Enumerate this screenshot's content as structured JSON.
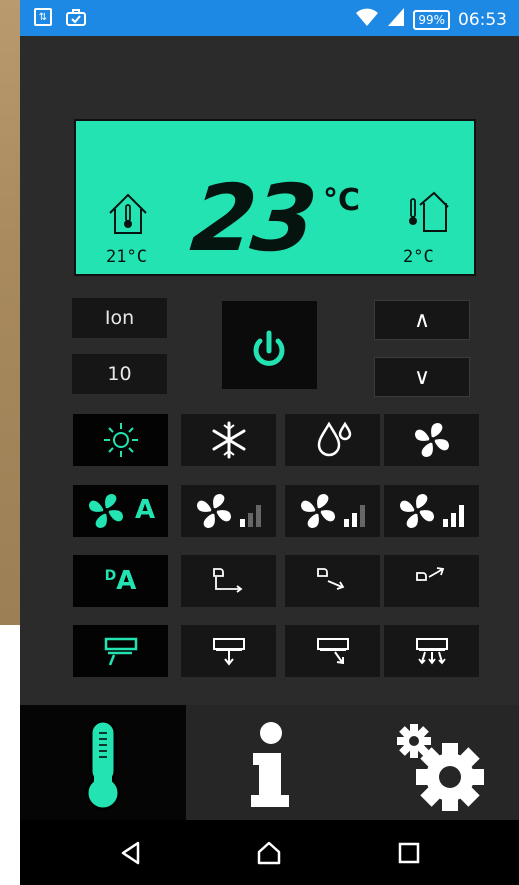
{
  "status_bar": {
    "battery": "99%",
    "time": "06:53",
    "icons": [
      "battery-saver-icon",
      "briefcase-icon",
      "wifi-icon",
      "signal-icon"
    ]
  },
  "display": {
    "set_temperature": "23",
    "unit": "°C",
    "indoor_temperature": "21°C",
    "outdoor_temperature": "2°C"
  },
  "controls": {
    "ion_label": "Ion",
    "timer_value": "10",
    "up_label": "∧",
    "down_label": "∨"
  },
  "mode_buttons": [
    {
      "icon": "sun-icon",
      "selected": true
    },
    {
      "icon": "snowflake-icon",
      "selected": false
    },
    {
      "icon": "droplet-icon",
      "selected": false
    },
    {
      "icon": "fan-icon",
      "selected": false
    }
  ],
  "fan_buttons": [
    {
      "icon": "fan-auto-icon",
      "label": "A",
      "selected": true
    },
    {
      "icon": "fan-speed-low-icon",
      "selected": false
    },
    {
      "icon": "fan-speed-mid-icon",
      "selected": false
    },
    {
      "icon": "fan-speed-high-icon",
      "selected": false
    }
  ],
  "swing_buttons": [
    {
      "icon": "swing-auto-icon",
      "prefix": "D",
      "label": "A",
      "selected": true
    },
    {
      "icon": "swing-horizontal-icon",
      "selected": false
    },
    {
      "icon": "swing-down-icon",
      "selected": false
    },
    {
      "icon": "swing-up-icon",
      "selected": false
    }
  ],
  "vane_buttons": [
    {
      "icon": "vane-auto-icon",
      "selected": true
    },
    {
      "icon": "vane-down-icon",
      "selected": false
    },
    {
      "icon": "vane-diagonal-icon",
      "selected": false
    },
    {
      "icon": "vane-spread-icon",
      "selected": false
    }
  ],
  "bottom_tabs": [
    {
      "icon": "thermometer-icon",
      "selected": true
    },
    {
      "icon": "info-icon",
      "selected": false
    },
    {
      "icon": "settings-gears-icon",
      "selected": false
    }
  ],
  "system_nav": [
    "back-icon",
    "home-icon",
    "recents-icon"
  ],
  "colors": {
    "accent": "#22e3b1",
    "status_bar": "#1e88e5",
    "background": "#2b2b2b",
    "button": "#161616"
  }
}
